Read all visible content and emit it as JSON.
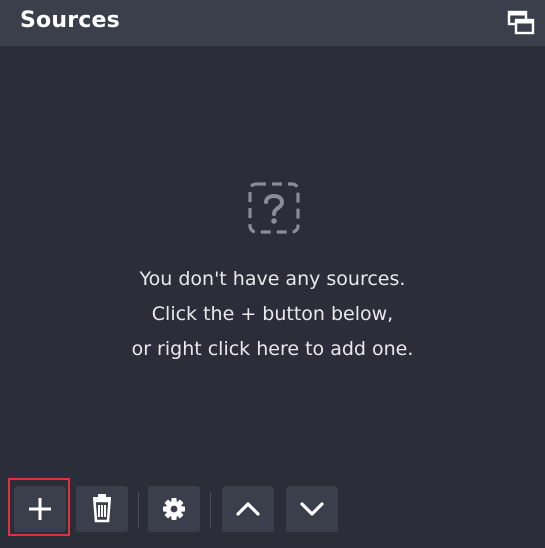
{
  "dock": {
    "title": "Sources"
  },
  "empty_state": {
    "line1": "You don't have any sources.",
    "line2": "Click the + button below,",
    "line3": "or right click here to add one."
  },
  "icons": {
    "undock": "undock-icon",
    "empty": "question-mark-icon",
    "add": "plus-icon",
    "remove": "trash-icon",
    "properties": "gear-icon",
    "move_up": "chevron-up-icon",
    "move_down": "chevron-down-icon"
  },
  "colors": {
    "panel_bg": "#2b2d38",
    "titlebar_bg": "#3b3e4b",
    "button_bg": "#3b3e4b",
    "highlight": "#e0313a",
    "text": "#e8e9ee"
  }
}
